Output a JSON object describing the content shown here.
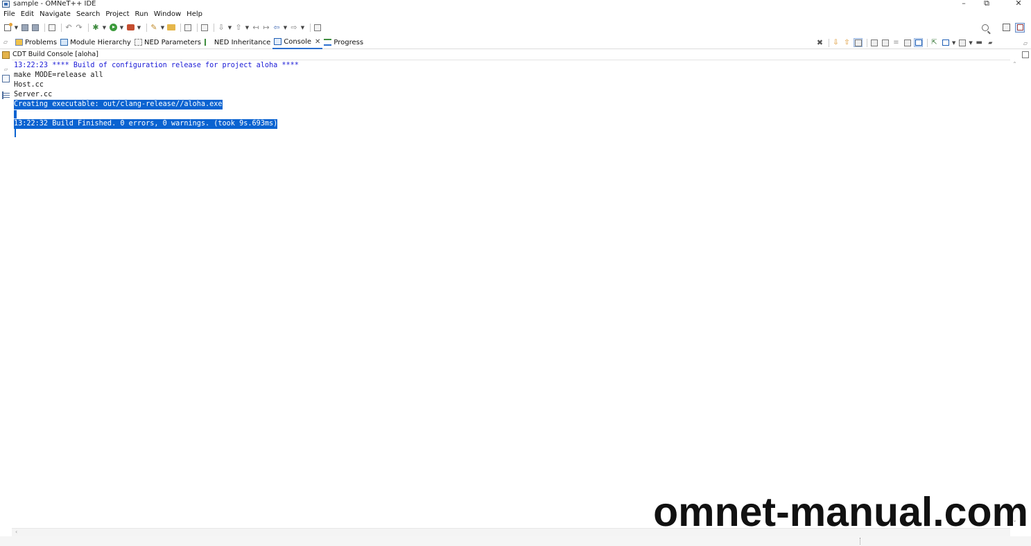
{
  "window": {
    "title": "sample - OMNeT++ IDE",
    "controls": {
      "minimize": "–",
      "restore": "⧉",
      "close": "✕"
    }
  },
  "menu": {
    "items": [
      "File",
      "Edit",
      "Navigate",
      "Search",
      "Project",
      "Run",
      "Window",
      "Help"
    ]
  },
  "tabs": [
    {
      "label": "Problems",
      "icon": "problems-icon"
    },
    {
      "label": "Module Hierarchy",
      "icon": "module-hierarchy-icon"
    },
    {
      "label": "NED Parameters",
      "icon": "ned-parameters-icon"
    },
    {
      "label": "NED Inheritance",
      "icon": "ned-inheritance-icon"
    },
    {
      "label": "Console",
      "icon": "console-icon",
      "active": true,
      "close": "✕"
    },
    {
      "label": "Progress",
      "icon": "progress-icon"
    }
  ],
  "console": {
    "name": "CDT Build Console [aloha]",
    "lines": [
      {
        "text": "13:22:23 **** Build of configuration release for project aloha ****",
        "style": "info"
      },
      {
        "text": "make MODE=release all",
        "style": "normal"
      },
      {
        "text": "Host.cc",
        "style": "normal"
      },
      {
        "text": "Server.cc",
        "style": "normal"
      },
      {
        "text": "Creating executable: out/clang-release//aloha.exe",
        "style": "selected"
      },
      {
        "text": "",
        "style": "selected"
      },
      {
        "text": "13:22:32 Build Finished. 0 errors, 0 warnings. (took 9s.693ms)",
        "style": "selected"
      }
    ]
  },
  "colors": {
    "selection": "#0a63d1",
    "info_text": "#1a1ad6",
    "active_tab_underline": "#2b6fcf"
  },
  "watermark": "omnet-manual.com"
}
